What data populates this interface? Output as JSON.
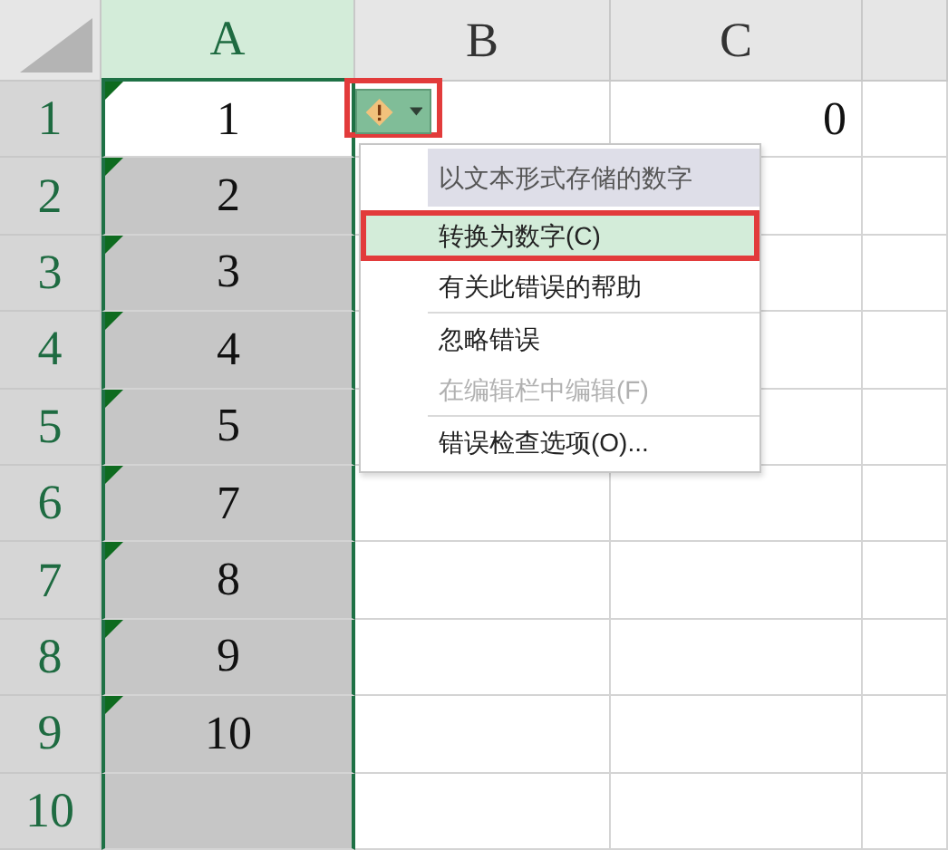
{
  "columns": [
    {
      "label": "A",
      "selected": true
    },
    {
      "label": "B",
      "selected": false
    },
    {
      "label": "C",
      "selected": false
    }
  ],
  "rows": [
    {
      "header": "1",
      "selected": true,
      "a": {
        "text": "1",
        "error": true,
        "active": true
      },
      "c": {
        "text": "0"
      }
    },
    {
      "header": "2",
      "selected": true,
      "a": {
        "text": "2",
        "error": true
      }
    },
    {
      "header": "3",
      "selected": true,
      "a": {
        "text": "3",
        "error": true
      }
    },
    {
      "header": "4",
      "selected": true,
      "a": {
        "text": "4",
        "error": true
      }
    },
    {
      "header": "5",
      "selected": true,
      "a": {
        "text": "5",
        "error": true
      }
    },
    {
      "header": "6",
      "selected": true,
      "a": {
        "text": "7",
        "error": true
      }
    },
    {
      "header": "7",
      "selected": true,
      "a": {
        "text": "8",
        "error": true
      }
    },
    {
      "header": "8",
      "selected": true,
      "a": {
        "text": "9",
        "error": true
      }
    },
    {
      "header": "9",
      "selected": true,
      "a": {
        "text": "10",
        "error": true
      }
    },
    {
      "header": "10",
      "selected": true
    }
  ],
  "error_button": {
    "highlighted": true
  },
  "error_menu": [
    {
      "kind": "header",
      "label": "以文本形式存储的数字"
    },
    {
      "kind": "item",
      "label": "转换为数字(C)",
      "selected": true,
      "highlighted": true,
      "disabled": false,
      "separator_after": false
    },
    {
      "kind": "item",
      "label": "有关此错误的帮助",
      "selected": false,
      "highlighted": false,
      "disabled": false,
      "separator_after": true
    },
    {
      "kind": "item",
      "label": "忽略错误",
      "selected": false,
      "highlighted": false,
      "disabled": false,
      "separator_after": false
    },
    {
      "kind": "item",
      "label": "在编辑栏中编辑(F)",
      "selected": false,
      "highlighted": false,
      "disabled": true,
      "separator_after": true
    },
    {
      "kind": "item",
      "label": "错误检查选项(O)...",
      "selected": false,
      "highlighted": false,
      "disabled": false,
      "separator_after": false
    }
  ]
}
